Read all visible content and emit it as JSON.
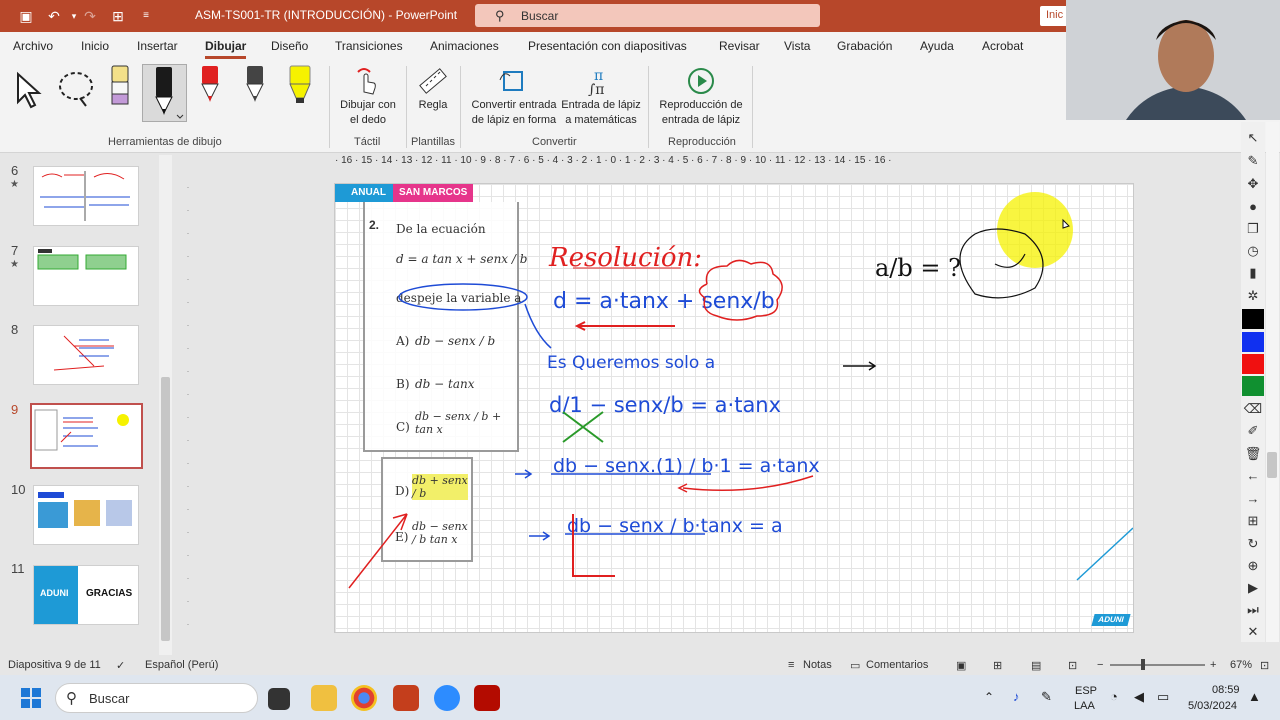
{
  "titlebar": {
    "doc_title": "ASM-TS001-TR (INTRODUCCIÓN)  -  PowerPoint",
    "search_placeholder": "Buscar",
    "signin": "Inic"
  },
  "menu": [
    "Archivo",
    "Inicio",
    "Insertar",
    "Dibujar",
    "Diseño",
    "Transiciones",
    "Animaciones",
    "Presentación con diapositivas",
    "Revisar",
    "Vista",
    "Grabación",
    "Ayuda",
    "Acrobat"
  ],
  "ribbon": {
    "groups": {
      "drawing_tools": "Herramientas de dibujo",
      "touch": "Táctil",
      "templates": "Plantillas",
      "convert": "Convertir",
      "playback": "Reproducción"
    },
    "buttons": {
      "finger_draw_1": "Dibujar con",
      "finger_draw_2": "el dedo",
      "ruler": "Regla",
      "ink_to_shape_1": "Convertir entrada",
      "ink_to_shape_2": "de lápiz en forma",
      "ink_to_math_1": "Entrada de lápiz",
      "ink_to_math_2": "a matemáticas",
      "ink_replay_1": "Reproducción de",
      "ink_replay_2": "entrada de lápiz"
    },
    "pen_colors": [
      "#f3e089",
      "#1a1a1a",
      "#e02020",
      "#444444",
      "#f6f200"
    ]
  },
  "ruler_labels": "· 16 · 15 · 14 · 13 · 12 · 11 · 10 · 9 · 8 · 7 · 6 · 5 · 4 · 3 · 2 · 1 · 0 · 1 · 2 · 3 · 4 · 5 · 6 · 7 · 8 · 9 · 10 · 11 · 12 · 13 · 14 · 15 · 16 ·",
  "thumbnails": [
    {
      "num": "6",
      "star": "★"
    },
    {
      "num": "7",
      "star": "★"
    },
    {
      "num": "8",
      "star": ""
    },
    {
      "num": "9",
      "star": ""
    },
    {
      "num": "10",
      "star": ""
    },
    {
      "num": "11",
      "star": "",
      "text": "GRACIAS",
      "brand": "ADUNI"
    }
  ],
  "slide": {
    "banner_left": "ANUAL",
    "banner_right": "SAN MARCOS",
    "question_number": "2.",
    "question_intro": "De la ecuación",
    "equation": "d = a tan x + senx / b",
    "instruction": "despeje la variable a.",
    "options": [
      {
        "label": "A)",
        "text": "db − senx / b"
      },
      {
        "label": "B)",
        "text": "db − tanx"
      },
      {
        "label": "C)",
        "text": "db − senx / b + tan x"
      },
      {
        "label": "D)",
        "text": "db + senx / b"
      },
      {
        "label": "E)",
        "text": "db − senx / b tan x"
      }
    ],
    "ink_title": "Resolución:",
    "ink_line1": "d = a·tanx + senx/b",
    "ink_line2": "Es Queremos solo a",
    "ink_line3": "d/1 − senx/b = a·tanx",
    "ink_line4": "db − senx.(1) / b·1 = a·tanx",
    "ink_line5": "db − senx / b·tanx = a",
    "ink_side": "a/b = ?",
    "logo": "ADUNI"
  },
  "statusbar": {
    "slide_info": "Diapositiva 9 de 11",
    "language": "Español (Perú)",
    "notes": "Notas",
    "comments": "Comentarios",
    "zoom": "67%"
  },
  "taskbar": {
    "search": "Buscar",
    "lang1": "ESP",
    "lang2": "LAA",
    "time": "08:59",
    "date": "5/03/2024"
  }
}
